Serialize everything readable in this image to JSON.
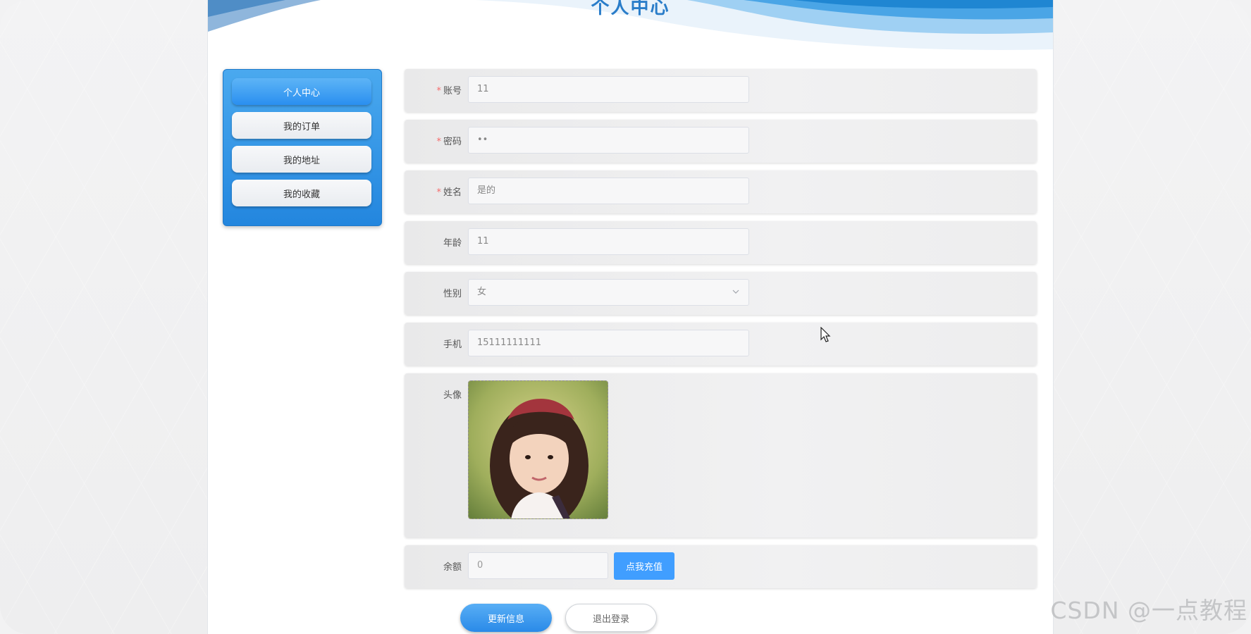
{
  "header": {
    "title": "个人中心"
  },
  "sidebar": {
    "items": [
      {
        "label": "个人中心",
        "active": true
      },
      {
        "label": "我的订单",
        "active": false
      },
      {
        "label": "我的地址",
        "active": false
      },
      {
        "label": "我的收藏",
        "active": false
      }
    ]
  },
  "form": {
    "account": {
      "label": "账号",
      "required": true,
      "value": "11"
    },
    "password": {
      "label": "密码",
      "required": true,
      "value": "••"
    },
    "name": {
      "label": "姓名",
      "required": true,
      "value": "是的"
    },
    "age": {
      "label": "年龄",
      "value": "11"
    },
    "gender": {
      "label": "性别",
      "value": "女"
    },
    "phone": {
      "label": "手机",
      "value": "15111111111"
    },
    "avatar": {
      "label": "头像"
    },
    "balance": {
      "label": "余额",
      "value": "0",
      "recharge_label": "点我充值"
    }
  },
  "actions": {
    "update_label": "更新信息",
    "logout_label": "退出登录"
  },
  "watermark": "CSDN @一点教程",
  "colors": {
    "primary": "#409eff",
    "sidebar": "#2386de",
    "required": "#f56c6c"
  }
}
